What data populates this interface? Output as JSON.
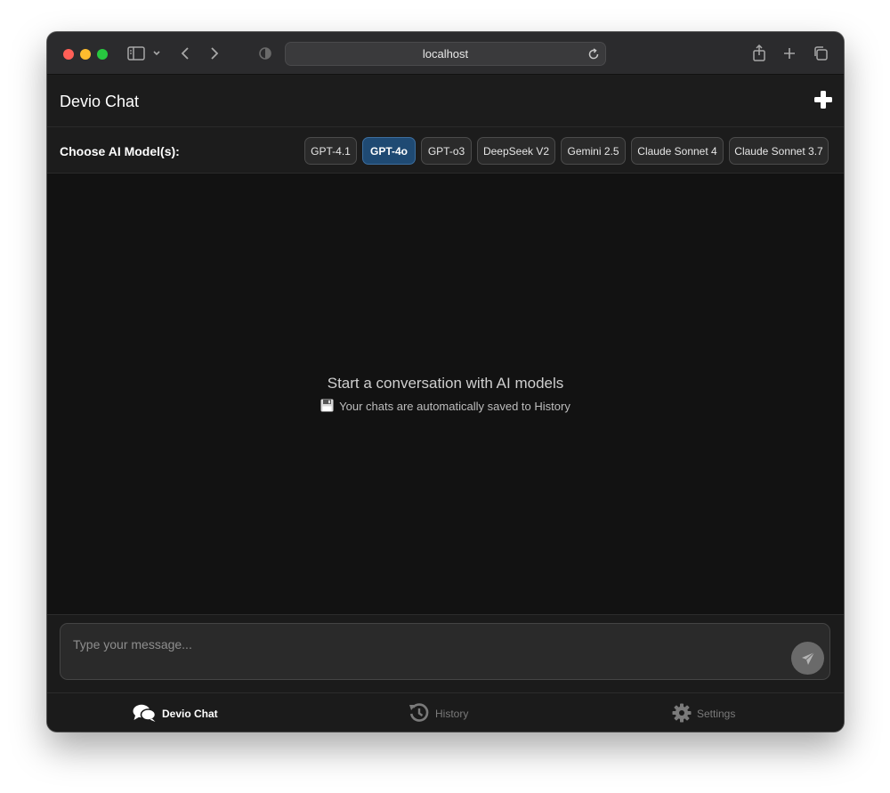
{
  "browser": {
    "url": "localhost"
  },
  "app": {
    "title": "Devio Chat"
  },
  "model_selector": {
    "label": "Choose AI Model(s):",
    "models": [
      {
        "label": "GPT-4.1",
        "selected": false
      },
      {
        "label": "GPT-4o",
        "selected": true
      },
      {
        "label": "GPT-o3",
        "selected": false
      },
      {
        "label": "DeepSeek V2",
        "selected": false
      },
      {
        "label": "Gemini 2.5",
        "selected": false
      },
      {
        "label": "Claude Sonnet 4",
        "selected": false
      },
      {
        "label": "Claude Sonnet 3.7",
        "selected": false
      }
    ]
  },
  "empty_state": {
    "title": "Start a conversation with AI models",
    "subtitle": "Your chats are automatically saved to History",
    "icon": "floppy-disk-icon"
  },
  "composer": {
    "placeholder": "Type your message...",
    "value": "",
    "send_icon": "paper-plane-icon"
  },
  "bottom_nav": {
    "items": [
      {
        "label": "Devio Chat",
        "icon": "chat-bubbles-icon",
        "active": true
      },
      {
        "label": "History",
        "icon": "history-icon",
        "active": false
      },
      {
        "label": "Settings",
        "icon": "gear-icon",
        "active": false
      }
    ]
  },
  "colors": {
    "accent_selected": "#1f4a73",
    "background": "#121212",
    "surface": "#1c1c1c"
  }
}
